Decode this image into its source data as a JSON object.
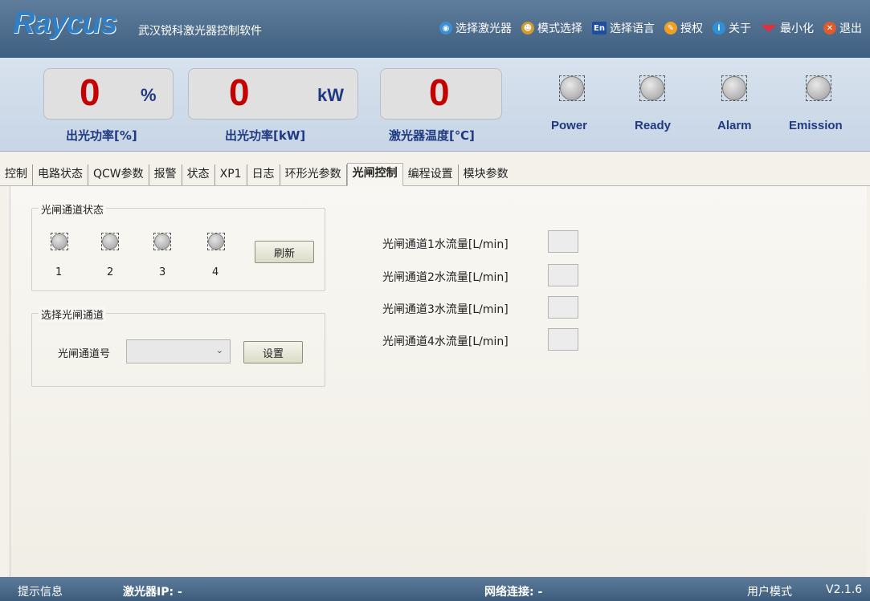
{
  "app": {
    "logo": "Raycus",
    "company": "武汉锐科激光器控制软件"
  },
  "topmenu": [
    {
      "label": "选择激光器",
      "icon": "laser-icon"
    },
    {
      "label": "模式选择",
      "icon": "users-icon"
    },
    {
      "label": "选择语言",
      "icon": "language-icon",
      "badge": "En"
    },
    {
      "label": "授权",
      "icon": "key-icon"
    },
    {
      "label": "关于",
      "icon": "info-icon"
    },
    {
      "label": "最小化",
      "icon": "minimize-icon"
    },
    {
      "label": "退出",
      "icon": "close-icon"
    }
  ],
  "gauges": [
    {
      "value": "0",
      "unit": "%",
      "label": "出光功率[%]"
    },
    {
      "value": "0",
      "unit": "kW",
      "label": "出光功率[kW]"
    },
    {
      "value": "0",
      "unit": "",
      "label": "激光器温度[℃]"
    }
  ],
  "indicators": [
    {
      "label": "Power"
    },
    {
      "label": "Ready"
    },
    {
      "label": "Alarm"
    },
    {
      "label": "Emission"
    }
  ],
  "tabs": [
    "控制",
    "电路状态",
    "QCW参数",
    "报警",
    "状态",
    "XP1",
    "日志",
    "环形光参数",
    "光闸控制",
    "编程设置",
    "模块参数"
  ],
  "active_tab": "光闸控制",
  "shutter_status": {
    "title": "光闸通道状态",
    "channels": [
      "1",
      "2",
      "3",
      "4"
    ],
    "refresh_label": "刷新"
  },
  "select_channel": {
    "title": "选择光闸通道",
    "field_label": "光闸通道号",
    "selected": "",
    "set_label": "设置"
  },
  "flows": [
    {
      "label": "光闸通道1水流量[L/min]",
      "value": ""
    },
    {
      "label": "光闸通道2水流量[L/min]",
      "value": ""
    },
    {
      "label": "光闸通道3水流量[L/min]",
      "value": ""
    },
    {
      "label": "光闸通道4水流量[L/min]",
      "value": ""
    }
  ],
  "status": {
    "hint": "提示信息",
    "ip": "激光器IP: -",
    "network": "网络连接: -",
    "mode": "用户模式",
    "version": "V2.1.6"
  },
  "colors": {
    "accent": "#2d7fc9",
    "value_red": "#c40000",
    "label_blue": "#1f3a82"
  }
}
